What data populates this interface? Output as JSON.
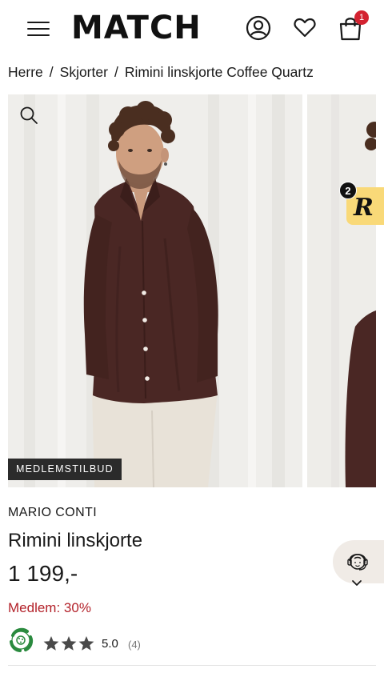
{
  "header": {
    "logo": "MATCH",
    "cart_count": "1"
  },
  "breadcrumb": {
    "items": [
      "Herre",
      "Skjorter",
      "Rimini linskjorte Coffee Quartz"
    ],
    "separator": "/"
  },
  "gallery": {
    "badge": "MEDLEMSTILBUD",
    "widget_count": "2",
    "widget_letter": "R",
    "shirt_color": "#4a2724"
  },
  "product": {
    "brand": "MARIO CONTI",
    "title": "Rimini linskjorte",
    "price": "1 199,-",
    "member_discount": "Medlem: 30%",
    "rating": "5.0",
    "review_count": "(4)",
    "stars_filled": 3
  },
  "colors": {
    "accent_red": "#d32230",
    "member_red": "#b3222a",
    "badge_bg": "#2b2b2b",
    "widget_yellow": "#f9d978"
  }
}
